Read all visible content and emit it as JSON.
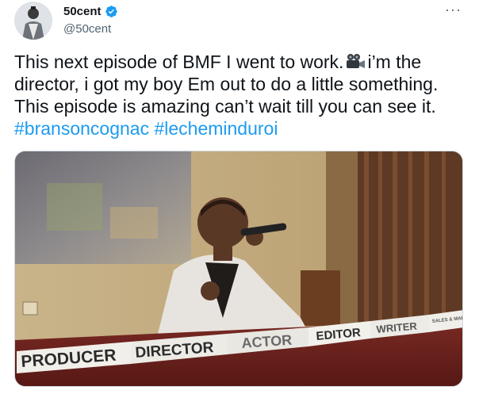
{
  "tweet": {
    "display_name": "50cent",
    "handle": "@50cent",
    "verified_icon": "verified-badge-icon",
    "more_label": "···",
    "text_lines": [
      "This next episode of BMF I went to work.",
      "i’m the",
      "director, i got my boy Em out to do a little something.",
      "This episode is amazing can’t wait till you can see it."
    ],
    "hashtags": [
      "#bransoncognac",
      "#lecheminduroi"
    ]
  },
  "media": {
    "name_cards": [
      "PRODUCER",
      "DIRECTOR",
      "ACTOR",
      "EDITOR",
      "WRITER",
      "SALES & MARKETING"
    ],
    "accent_colors": {
      "hashtag": "#1d9bf0",
      "verified": "#1d9bf0"
    }
  }
}
